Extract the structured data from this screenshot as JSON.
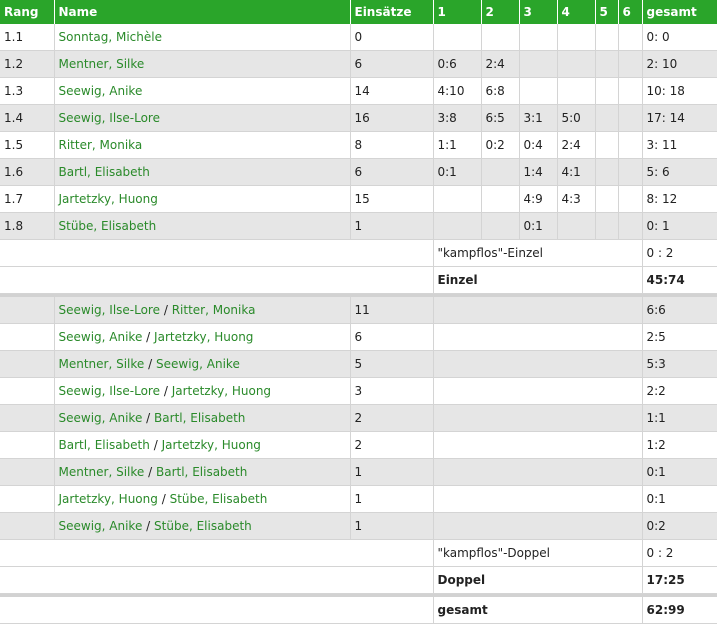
{
  "headers": {
    "rank": "Rang",
    "name": "Name",
    "einsaetze": "Einsätze",
    "s1": "1",
    "s2": "2",
    "s3": "3",
    "s4": "4",
    "s5": "5",
    "s6": "6",
    "total": "gesamt"
  },
  "singles": [
    {
      "rank": "1.1",
      "name": "Sonntag, Michèle",
      "einsaetze": "0",
      "s1": "",
      "s2": "",
      "s3": "",
      "s4": "",
      "s5": "",
      "s6": "",
      "total": "0: 0"
    },
    {
      "rank": "1.2",
      "name": "Mentner, Silke",
      "einsaetze": "6",
      "s1": "0:6",
      "s2": "2:4",
      "s3": "",
      "s4": "",
      "s5": "",
      "s6": "",
      "total": "2: 10"
    },
    {
      "rank": "1.3",
      "name": "Seewig, Anike",
      "einsaetze": "14",
      "s1": "4:10",
      "s2": "6:8",
      "s3": "",
      "s4": "",
      "s5": "",
      "s6": "",
      "total": "10: 18"
    },
    {
      "rank": "1.4",
      "name": "Seewig, Ilse-Lore",
      "einsaetze": "16",
      "s1": "3:8",
      "s2": "6:5",
      "s3": "3:1",
      "s4": "5:0",
      "s5": "",
      "s6": "",
      "total": "17: 14"
    },
    {
      "rank": "1.5",
      "name": "Ritter, Monika",
      "einsaetze": "8",
      "s1": "1:1",
      "s2": "0:2",
      "s3": "0:4",
      "s4": "2:4",
      "s5": "",
      "s6": "",
      "total": "3: 11"
    },
    {
      "rank": "1.6",
      "name": "Bartl, Elisabeth",
      "einsaetze": "6",
      "s1": "0:1",
      "s2": "",
      "s3": "1:4",
      "s4": "4:1",
      "s5": "",
      "s6": "",
      "total": "5: 6"
    },
    {
      "rank": "1.7",
      "name": "Jartetzky, Huong",
      "einsaetze": "15",
      "s1": "",
      "s2": "",
      "s3": "4:9",
      "s4": "4:3",
      "s5": "",
      "s6": "",
      "total": "8: 12"
    },
    {
      "rank": "1.8",
      "name": "Stübe, Elisabeth",
      "einsaetze": "1",
      "s1": "",
      "s2": "",
      "s3": "0:1",
      "s4": "",
      "s5": "",
      "s6": "",
      "total": "0: 1"
    }
  ],
  "singles_kampflos": {
    "label": "\"kampflos\"-Einzel",
    "value": "0 : 2"
  },
  "singles_total": {
    "label": "Einzel",
    "value": "45:74"
  },
  "doubles": [
    {
      "p1": "Seewig, Ilse-Lore",
      "p2": "Ritter, Monika",
      "einsaetze": "11",
      "total": "6:6"
    },
    {
      "p1": "Seewig, Anike",
      "p2": "Jartetzky, Huong",
      "einsaetze": "6",
      "total": "2:5"
    },
    {
      "p1": "Mentner, Silke",
      "p2": "Seewig, Anike",
      "einsaetze": "5",
      "total": "5:3"
    },
    {
      "p1": "Seewig, Ilse-Lore",
      "p2": "Jartetzky, Huong",
      "einsaetze": "3",
      "total": "2:2"
    },
    {
      "p1": "Seewig, Anike",
      "p2": "Bartl, Elisabeth",
      "einsaetze": "2",
      "total": "1:1"
    },
    {
      "p1": "Bartl, Elisabeth",
      "p2": "Jartetzky, Huong",
      "einsaetze": "2",
      "total": "1:2"
    },
    {
      "p1": "Mentner, Silke",
      "p2": "Bartl, Elisabeth",
      "einsaetze": "1",
      "total": "0:1"
    },
    {
      "p1": "Jartetzky, Huong",
      "p2": "Stübe, Elisabeth",
      "einsaetze": "1",
      "total": "0:1"
    },
    {
      "p1": "Seewig, Anike",
      "p2": "Stübe, Elisabeth",
      "einsaetze": "1",
      "total": "0:2"
    }
  ],
  "pair_separator": "/",
  "doubles_kampflos": {
    "label": "\"kampflos\"-Doppel",
    "value": "0 : 2"
  },
  "doubles_total": {
    "label": "Doppel",
    "value": "17:25"
  },
  "grand_total": {
    "label": "gesamt",
    "value": "62:99"
  },
  "colors": {
    "header_bg": "#2aa52a",
    "name_link": "#2a8a2a",
    "alt_row": "#e6e6e6"
  }
}
